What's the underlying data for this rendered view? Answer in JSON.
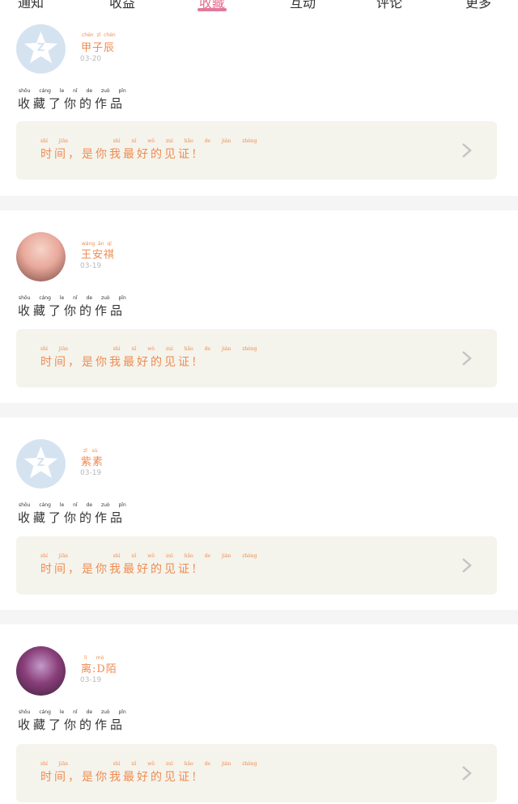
{
  "nav": {
    "tabs": [
      "通知",
      "收益",
      "收藏",
      "互动",
      "评论",
      "更多"
    ],
    "active_index": 2
  },
  "posts": [
    {
      "username": "甲子辰",
      "username_pinyin": [
        "chén",
        "zǐ",
        "chén"
      ],
      "date": "03-20",
      "avatar": "default-avatar",
      "action": "收藏了你的作品",
      "action_pinyin": [
        "shōu",
        "cáng",
        "le",
        "nǐ",
        "de",
        "zuò",
        "pǐn"
      ],
      "quote": "时间，是你我最好的见证!",
      "quote_pinyin": [
        "shí",
        "jiān",
        "shì",
        "nǐ",
        "wǒ",
        "zuì",
        "hǎo",
        "de",
        "jiàn",
        "zhèng"
      ]
    },
    {
      "username": "王安祺",
      "username_pinyin": [
        "wáng",
        "ān",
        "qí"
      ],
      "date": "03-19",
      "avatar": "photo-avatar",
      "action": "收藏了你的作品",
      "action_pinyin": [
        "shōu",
        "cáng",
        "le",
        "nǐ",
        "de",
        "zuò",
        "pǐn"
      ],
      "quote": "时间，是你我最好的见证!",
      "quote_pinyin": [
        "shí",
        "jiān",
        "shì",
        "nǐ",
        "wǒ",
        "zuì",
        "hǎo",
        "de",
        "jiàn",
        "zhèng"
      ]
    },
    {
      "username": "紫素",
      "username_pinyin": [
        "zǐ",
        "sù"
      ],
      "date": "03-19",
      "avatar": "default-avatar",
      "action": "收藏了你的作品",
      "action_pinyin": [
        "shōu",
        "cáng",
        "le",
        "nǐ",
        "de",
        "zuò",
        "pǐn"
      ],
      "quote": "时间，是你我最好的见证!",
      "quote_pinyin": [
        "shí",
        "jiān",
        "shì",
        "nǐ",
        "wǒ",
        "zuì",
        "hǎo",
        "de",
        "jiàn",
        "zhèng"
      ]
    },
    {
      "username": "离:D陌",
      "username_pinyin": [
        "lí",
        "mò"
      ],
      "date": "03-19",
      "avatar": "photo-avatar",
      "action": "收藏了你的作品",
      "action_pinyin": [
        "shōu",
        "cáng",
        "le",
        "nǐ",
        "de",
        "zuò",
        "pǐn"
      ],
      "quote": "时间，是你我最好的见证!",
      "quote_pinyin": [
        "shí",
        "jiān",
        "shì",
        "nǐ",
        "wǒ",
        "zuì",
        "hǎo",
        "de",
        "jiàn",
        "zhèng"
      ]
    }
  ],
  "colors": {
    "accent": "#e07a9a",
    "username": "#f08a50",
    "quote_bg": "#f4f4ec",
    "separator": "#f5f5f5"
  }
}
